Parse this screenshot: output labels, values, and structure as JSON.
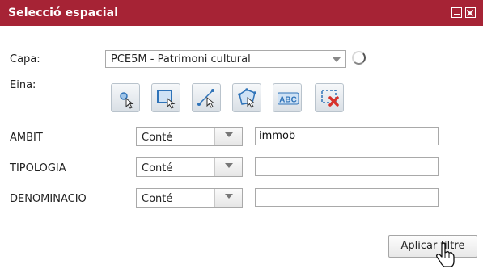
{
  "window": {
    "title": "Selecció espacial"
  },
  "form": {
    "layer_label": "Capa:",
    "layer_value": "PCE5M - Patrimoni cultural",
    "tool_label": "Eina:",
    "tools": [
      {
        "name": "point-select-icon"
      },
      {
        "name": "rectangle-select-icon"
      },
      {
        "name": "line-select-icon"
      },
      {
        "name": "polygon-select-icon"
      },
      {
        "name": "abc-text-icon",
        "text": "ABC"
      },
      {
        "name": "clear-selection-icon"
      }
    ],
    "filters": [
      {
        "field": "AMBIT",
        "condition": "Conté",
        "value": "immob"
      },
      {
        "field": "TIPOLOGIA",
        "condition": "Conté",
        "value": ""
      },
      {
        "field": "DENOMINACIO",
        "condition": "Conté",
        "value": ""
      }
    ],
    "apply_label": "Aplicar filtre"
  },
  "colors": {
    "titlebar": "#a62335",
    "tool_accent": "#2f73b8",
    "clear_red": "#d8322b"
  }
}
